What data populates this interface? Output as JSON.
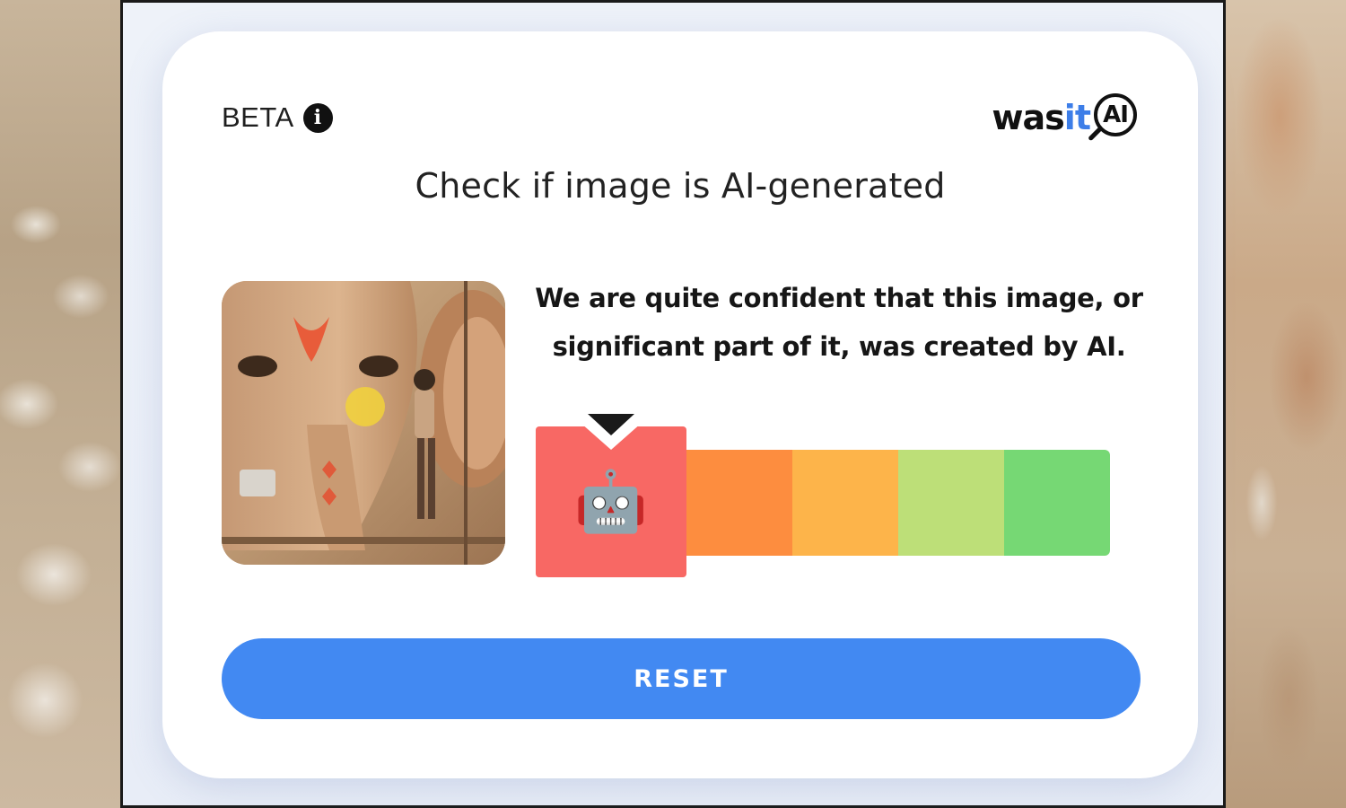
{
  "header": {
    "beta_label": "BETA",
    "info_icon": "info-icon",
    "logo": {
      "text_main": "was",
      "text_accent": "it",
      "mark_text": "AI",
      "accent_color": "#3d7ee8"
    }
  },
  "main": {
    "title": "Check if image is AI-generated",
    "result_message": "We are quite confident that this image, or significant part of it, was created by AI.",
    "meter": {
      "levels": [
        "red",
        "orange",
        "amber",
        "lime",
        "green"
      ],
      "colors": [
        "#f86864",
        "#fd8d3f",
        "#fdb44a",
        "#bddf78",
        "#76d874"
      ],
      "selected_index": 0,
      "selected_icon": "robot-face-icon",
      "selected_glyph": "🤖"
    },
    "uploaded_image": "thumbnail of elephant-headed statue being painted by a worker"
  },
  "actions": {
    "reset_label": "RESET",
    "reset_color": "#4289f2"
  }
}
